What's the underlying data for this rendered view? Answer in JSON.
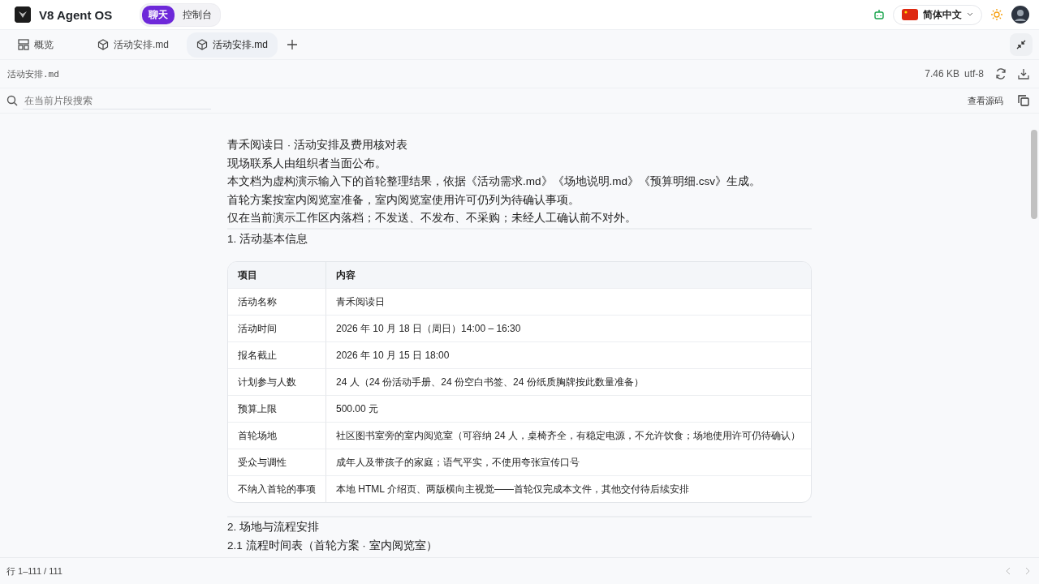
{
  "app": {
    "title": "V8 Agent OS",
    "modes": [
      {
        "label": "聊天",
        "selected": true
      },
      {
        "label": "控制台",
        "selected": false
      }
    ],
    "language": "简体中文"
  },
  "tabs": [
    {
      "label": "概览",
      "kind": "overview",
      "selected": false
    },
    {
      "label": "活动安排.md",
      "kind": "file",
      "selected": false
    },
    {
      "label": "活动安排.md",
      "kind": "file",
      "selected": true
    }
  ],
  "file": {
    "name": "活动安排.md",
    "size": "7.46 KB",
    "encoding": "utf-8"
  },
  "search": {
    "placeholder": "在当前片段搜索"
  },
  "view_source": "查看源码",
  "document": {
    "intro": [
      "青禾阅读日 · 活动安排及费用核对表",
      "现场联系人由组织者当面公布。",
      "本文档为虚构演示输入下的首轮整理结果，依据《活动需求.md》《场地说明.md》《预算明细.csv》生成。",
      "首轮方案按室内阅览室准备，室内阅览室使用许可仍列为待确认事项。",
      "仅在当前演示工作区内落档；不发送、不发布、不采购；未经人工确认前不对外。"
    ],
    "section_1": "1. 活动基本信息",
    "table": {
      "columns": [
        "项目",
        "内容"
      ],
      "rows": [
        [
          "活动名称",
          "青禾阅读日"
        ],
        [
          "活动时间",
          "2026 年 10 月 18 日（周日）14:00 – 16:30"
        ],
        [
          "报名截止",
          "2026 年 10 月 15 日 18:00"
        ],
        [
          "计划参与人数",
          "24 人（24 份活动手册、24 份空白书签、24 份纸质胸牌按此数量准备）"
        ],
        [
          "预算上限",
          "500.00 元"
        ],
        [
          "首轮场地",
          "社区图书室旁的室内阅览室（可容纳 24 人，桌椅齐全，有稳定电源，不允许饮食；场地使用许可仍待确认）"
        ],
        [
          "受众与调性",
          "成年人及带孩子的家庭；语气平实，不使用夸张宣传口号"
        ],
        [
          "不纳入首轮的事项",
          "本地 HTML 介绍页、两版横向主视觉——首轮仅完成本文件，其他交付待后续安排"
        ]
      ]
    },
    "section_2": "2. 场地与流程安排",
    "section_2_1": "2.1 流程时间表（首轮方案 · 室内阅览室）"
  },
  "status_bar": {
    "lines": "行 1–111 / 111"
  }
}
